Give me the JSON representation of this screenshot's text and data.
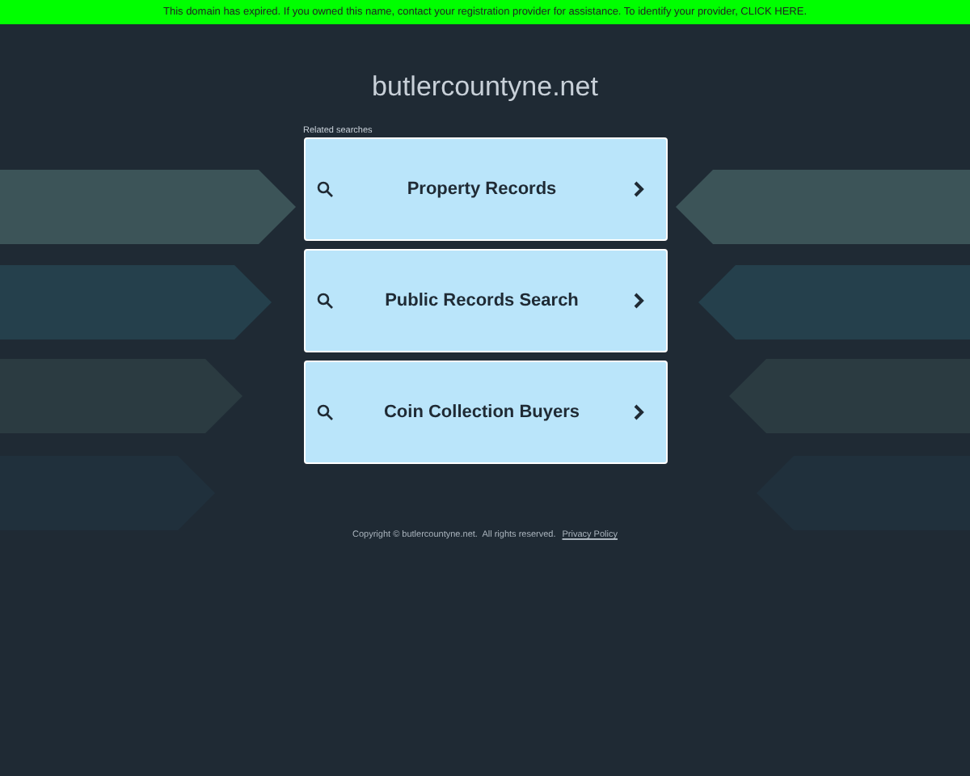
{
  "banner": {
    "text": "This domain has expired. If you owned this name, contact your registration provider for assistance. To identify your provider, CLICK HERE."
  },
  "site_title": "butlercountyne.net",
  "related": {
    "heading": "Related searches",
    "items": [
      {
        "label": "Property Records"
      },
      {
        "label": "Public Records Search"
      },
      {
        "label": "Coin Collection Buyers"
      }
    ]
  },
  "footer": {
    "copyright": "Copyright © butlercountyne.net.  All rights reserved.",
    "link": "Privacy Policy"
  }
}
